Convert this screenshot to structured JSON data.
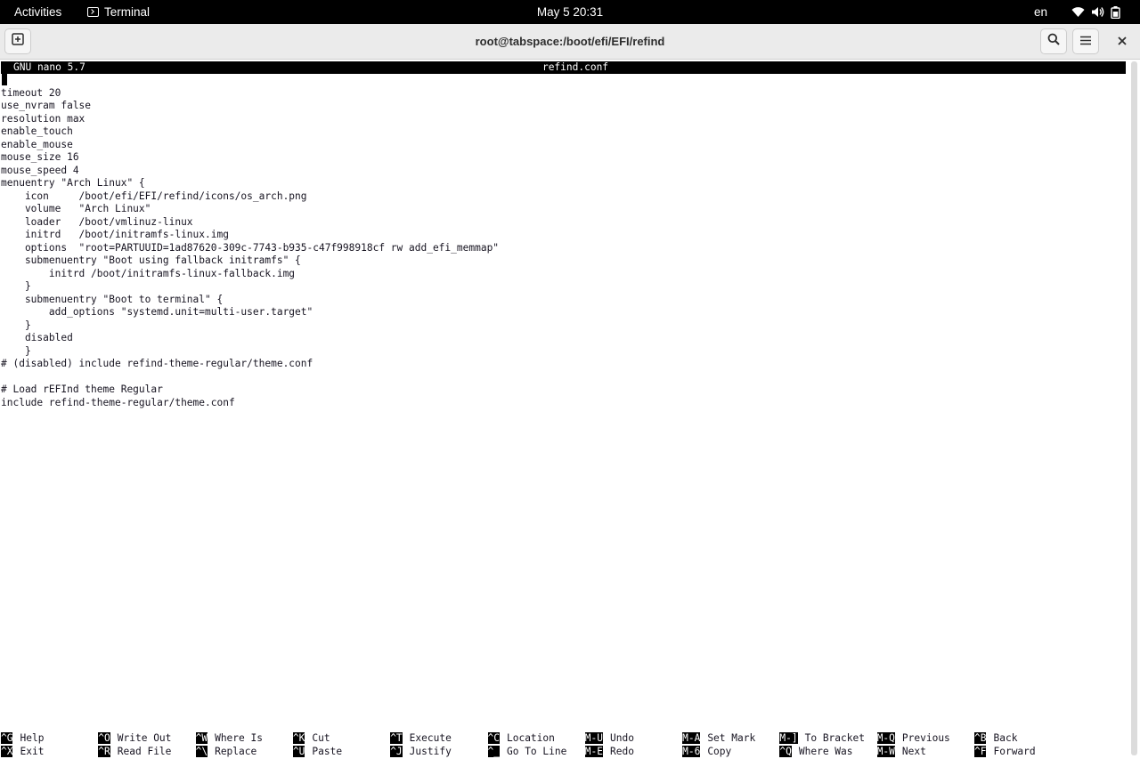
{
  "topbar": {
    "activities": "Activities",
    "app_name": "Terminal",
    "clock": "May 5  20:31",
    "language": "en",
    "icons": [
      "wifi-icon",
      "volume-icon",
      "battery-icon"
    ]
  },
  "window": {
    "title": "root@tabspace:/boot/efi/EFI/refind",
    "buttons": [
      "new-tab-icon",
      "search-icon",
      "hamburger-menu-icon",
      "close-icon"
    ]
  },
  "nano": {
    "version": "GNU nano 5.7",
    "filename": "refind.conf",
    "lines": [
      "",
      "timeout 20",
      "use_nvram false",
      "resolution max",
      "enable_touch",
      "enable_mouse",
      "mouse_size 16",
      "mouse_speed 4",
      "menuentry \"Arch Linux\" {",
      "    icon     /boot/efi/EFI/refind/icons/os_arch.png",
      "    volume   \"Arch Linux\"",
      "    loader   /boot/vmlinuz-linux",
      "    initrd   /boot/initramfs-linux.img",
      "    options  \"root=PARTUUID=1ad87620-309c-7743-b935-c47f998918cf rw add_efi_memmap\"",
      "    submenuentry \"Boot using fallback initramfs\" {",
      "        initrd /boot/initramfs-linux-fallback.img",
      "    }",
      "    submenuentry \"Boot to terminal\" {",
      "        add_options \"systemd.unit=multi-user.target\"",
      "    }",
      "    disabled",
      "    }",
      "# (disabled) include refind-theme-regular/theme.conf",
      "",
      "# Load rEFInd theme Regular",
      "include refind-theme-regular/theme.conf"
    ],
    "shortcuts_row1": [
      {
        "key": "^G",
        "label": "Help"
      },
      {
        "key": "^O",
        "label": "Write Out"
      },
      {
        "key": "^W",
        "label": "Where Is"
      },
      {
        "key": "^K",
        "label": "Cut"
      },
      {
        "key": "^T",
        "label": "Execute"
      },
      {
        "key": "^C",
        "label": "Location"
      },
      {
        "key": "M-U",
        "label": "Undo"
      },
      {
        "key": "M-A",
        "label": "Set Mark"
      },
      {
        "key": "M-]",
        "label": "To Bracket"
      },
      {
        "key": "M-Q",
        "label": "Previous"
      },
      {
        "key": "^B",
        "label": "Back"
      }
    ],
    "shortcuts_row2": [
      {
        "key": "^X",
        "label": "Exit"
      },
      {
        "key": "^R",
        "label": "Read File"
      },
      {
        "key": "^\\",
        "label": "Replace"
      },
      {
        "key": "^U",
        "label": "Paste"
      },
      {
        "key": "^J",
        "label": "Justify"
      },
      {
        "key": "^_",
        "label": "Go To Line"
      },
      {
        "key": "M-E",
        "label": "Redo"
      },
      {
        "key": "M-6",
        "label": "Copy"
      },
      {
        "key": "^Q",
        "label": "Where Was"
      },
      {
        "key": "M-W",
        "label": "Next"
      },
      {
        "key": "^F",
        "label": "Forward"
      }
    ]
  }
}
